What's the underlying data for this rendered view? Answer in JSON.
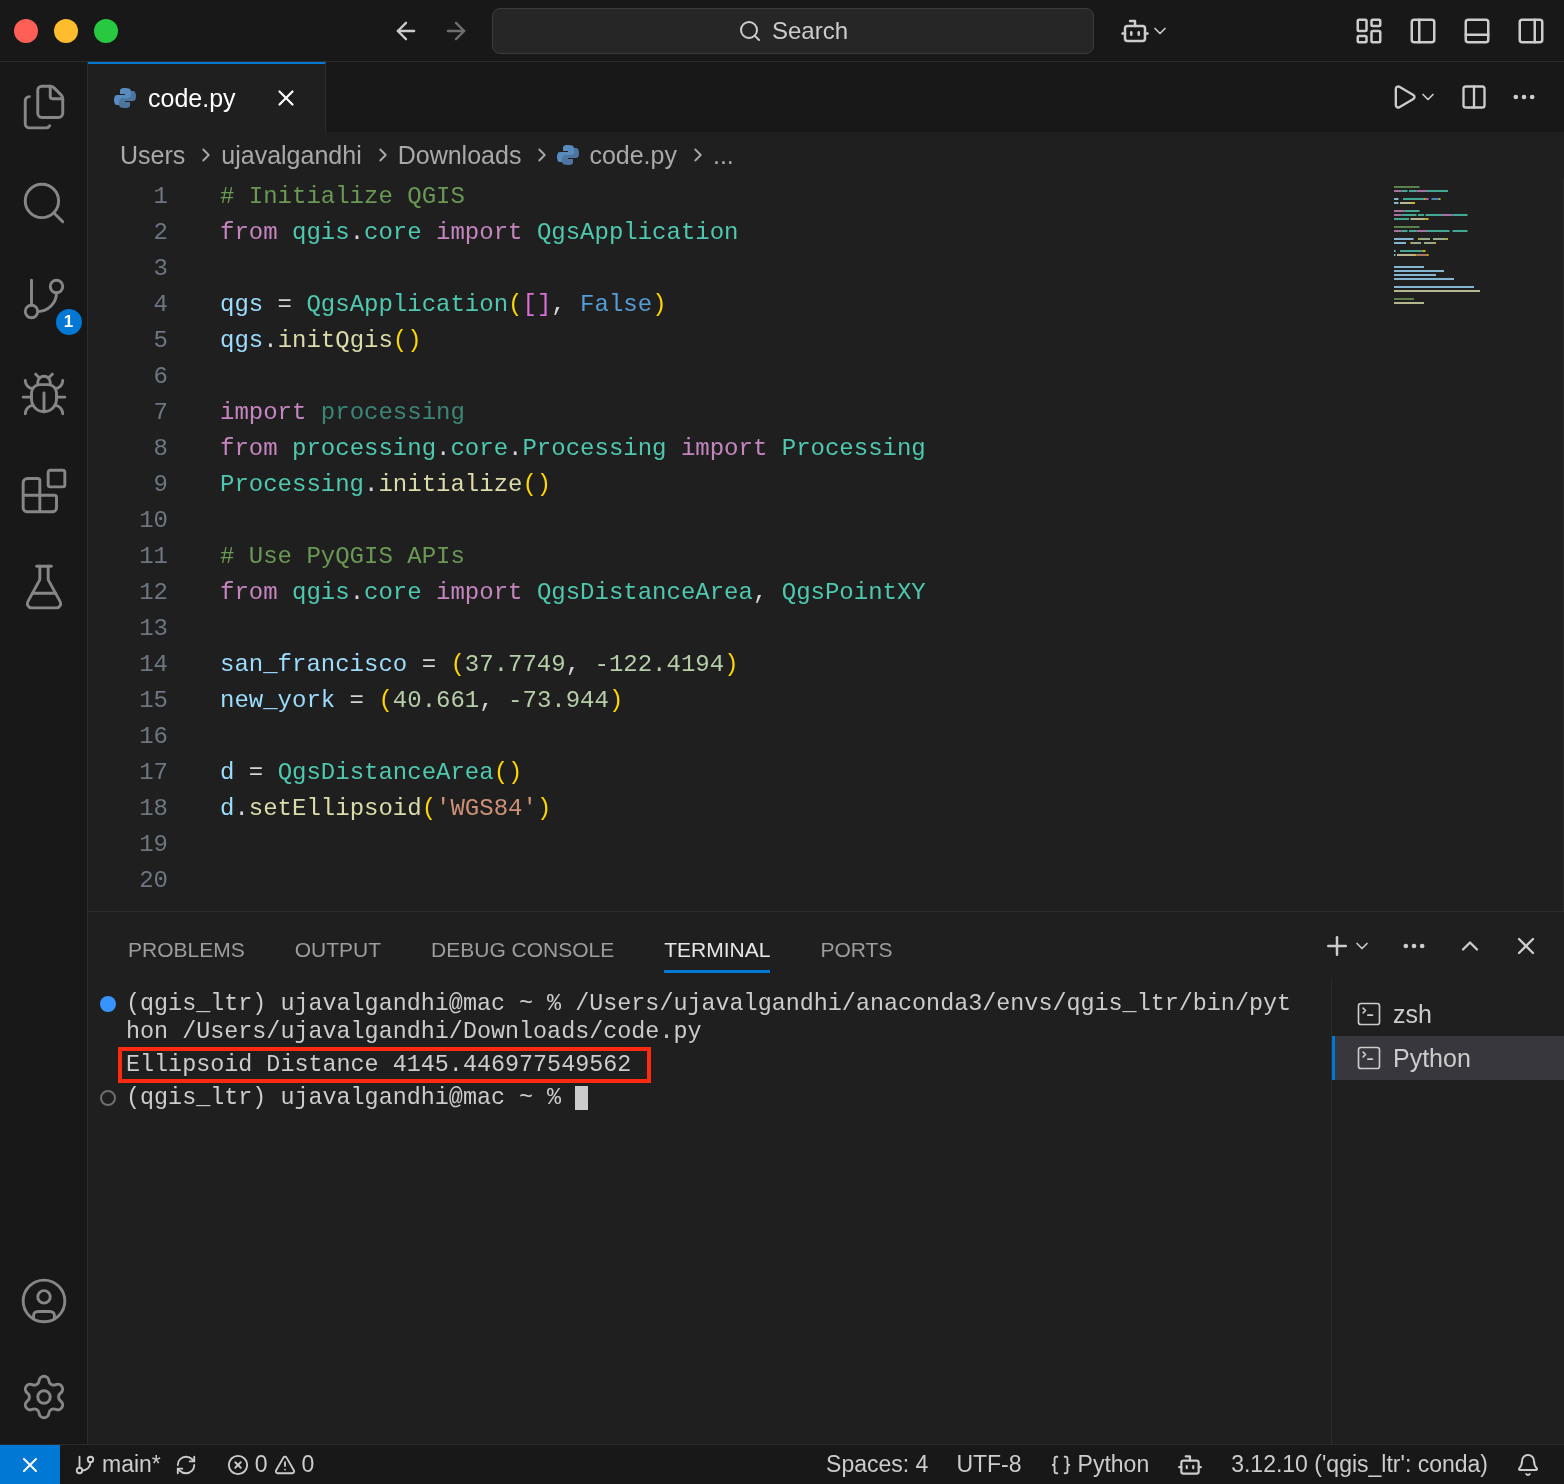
{
  "title_bar": {
    "search": {
      "placeholder": "Search"
    }
  },
  "activity_bar": {
    "items": [
      {
        "kind": "files"
      },
      {
        "kind": "search"
      },
      {
        "kind": "source-control",
        "badge": "1"
      },
      {
        "kind": "run"
      },
      {
        "kind": "extensions"
      },
      {
        "kind": "testing"
      }
    ],
    "bottom": [
      {
        "kind": "account"
      },
      {
        "kind": "settings"
      }
    ]
  },
  "editor": {
    "tabs": [
      {
        "label": "code.py",
        "selected": true
      }
    ],
    "breadcrumbs": [
      {
        "label": "Users",
        "kind": "folder"
      },
      {
        "label": "ujavalgandhi",
        "kind": "folder"
      },
      {
        "label": "Downloads",
        "kind": "folder"
      },
      {
        "label": "code.py",
        "kind": "file"
      },
      {
        "label": "...",
        "kind": "more"
      }
    ],
    "lines": [
      {
        "number": "1",
        "tokens": [
          {
            "text": "# Initialize QGIS",
            "kind": "comment"
          }
        ]
      },
      {
        "number": "2",
        "tokens": [
          {
            "text": "from ",
            "kind": "keyword"
          },
          {
            "text": "qgis",
            "kind": "module"
          },
          {
            "text": ".",
            "kind": "plain"
          },
          {
            "text": "core ",
            "kind": "module"
          },
          {
            "text": "import ",
            "kind": "keyword"
          },
          {
            "text": "QgsApplication",
            "kind": "class"
          }
        ]
      },
      {
        "number": "3"
      },
      {
        "number": "4",
        "tokens": [
          {
            "text": "qgs",
            "kind": "var"
          },
          {
            "text": " = ",
            "kind": "plain"
          },
          {
            "text": "QgsApplication",
            "kind": "class"
          },
          {
            "text": "(",
            "kind": "paren"
          },
          {
            "text": "[]",
            "kind": "bracket"
          },
          {
            "text": ", ",
            "kind": "plain"
          },
          {
            "text": "False",
            "kind": "const"
          },
          {
            "text": ")",
            "kind": "paren"
          }
        ]
      },
      {
        "number": "5",
        "tokens": [
          {
            "text": "qgs",
            "kind": "var"
          },
          {
            "text": ".",
            "kind": "plain"
          },
          {
            "text": "initQgis",
            "kind": "func"
          },
          {
            "text": "()",
            "kind": "paren"
          }
        ]
      },
      {
        "number": "6"
      },
      {
        "number": "7",
        "tokens": [
          {
            "text": "import ",
            "kind": "keyword"
          },
          {
            "text": "processing",
            "kind": "unused"
          }
        ]
      },
      {
        "number": "8",
        "tokens": [
          {
            "text": "from ",
            "kind": "keyword"
          },
          {
            "text": "processing",
            "kind": "module"
          },
          {
            "text": ".",
            "kind": "plain"
          },
          {
            "text": "core",
            "kind": "module"
          },
          {
            "text": ".",
            "kind": "plain"
          },
          {
            "text": "Processing ",
            "kind": "module"
          },
          {
            "text": "import ",
            "kind": "keyword"
          },
          {
            "text": "Processing",
            "kind": "class"
          }
        ]
      },
      {
        "number": "9",
        "tokens": [
          {
            "text": "Processing",
            "kind": "class"
          },
          {
            "text": ".",
            "kind": "plain"
          },
          {
            "text": "initialize",
            "kind": "func"
          },
          {
            "text": "()",
            "kind": "paren"
          }
        ]
      },
      {
        "number": "10"
      },
      {
        "number": "11",
        "tokens": [
          {
            "text": "# Use PyQGIS APIs",
            "kind": "comment"
          }
        ]
      },
      {
        "number": "12",
        "tokens": [
          {
            "text": "from ",
            "kind": "keyword"
          },
          {
            "text": "qgis",
            "kind": "module"
          },
          {
            "text": ".",
            "kind": "plain"
          },
          {
            "text": "core ",
            "kind": "module"
          },
          {
            "text": "import ",
            "kind": "keyword"
          },
          {
            "text": "QgsDistanceArea",
            "kind": "class"
          },
          {
            "text": ", ",
            "kind": "plain"
          },
          {
            "text": "QgsPointXY",
            "kind": "class"
          }
        ]
      },
      {
        "number": "13"
      },
      {
        "number": "14",
        "tokens": [
          {
            "text": "san_francisco",
            "kind": "var"
          },
          {
            "text": " = ",
            "kind": "plain"
          },
          {
            "text": "(",
            "kind": "paren"
          },
          {
            "text": "37.7749",
            "kind": "number"
          },
          {
            "text": ", ",
            "kind": "plain"
          },
          {
            "text": "-122.4194",
            "kind": "number"
          },
          {
            "text": ")",
            "kind": "paren"
          }
        ]
      },
      {
        "number": "15",
        "tokens": [
          {
            "text": "new_york",
            "kind": "var"
          },
          {
            "text": " = ",
            "kind": "plain"
          },
          {
            "text": "(",
            "kind": "paren"
          },
          {
            "text": "40.661",
            "kind": "number"
          },
          {
            "text": ", ",
            "kind": "plain"
          },
          {
            "text": "-73.944",
            "kind": "number"
          },
          {
            "text": ")",
            "kind": "paren"
          }
        ]
      },
      {
        "number": "16"
      },
      {
        "number": "17",
        "tokens": [
          {
            "text": "d",
            "kind": "var"
          },
          {
            "text": " = ",
            "kind": "plain"
          },
          {
            "text": "QgsDistanceArea",
            "kind": "class"
          },
          {
            "text": "()",
            "kind": "paren"
          }
        ]
      },
      {
        "number": "18",
        "tokens": [
          {
            "text": "d",
            "kind": "var"
          },
          {
            "text": ".",
            "kind": "plain"
          },
          {
            "text": "setEllipsoid",
            "kind": "func"
          },
          {
            "text": "(",
            "kind": "paren"
          },
          {
            "text": "'WGS84'",
            "kind": "string"
          },
          {
            "text": ")",
            "kind": "paren"
          }
        ]
      },
      {
        "number": "19"
      },
      {
        "number": "20"
      }
    ]
  },
  "panel": {
    "tabs": [
      {
        "label": "PROBLEMS",
        "selected": false
      },
      {
        "label": "OUTPUT",
        "selected": false
      },
      {
        "label": "DEBUG CONSOLE",
        "selected": false
      },
      {
        "label": "TERMINAL",
        "selected": true
      },
      {
        "label": "PORTS",
        "selected": false
      }
    ],
    "terminal_lines": [
      {
        "text": "(qgis_ltr) ujavalgandhi@mac ~ % /Users/ujavalgandhi/anaconda3/envs/qgis_ltr/bin/pyt",
        "kind": "finished_command"
      },
      {
        "text": "hon /Users/ujavalgandhi/Downloads/code.py",
        "kind": "continuation"
      },
      {
        "text": "Ellipsoid Distance 4145.446977549562",
        "kind": "output",
        "highlighted": true
      },
      {
        "text": "(qgis_ltr) ujavalgandhi@mac ~ %",
        "kind": "prompt",
        "cursor": true
      }
    ],
    "sessions": [
      {
        "label": "zsh",
        "selected": false
      },
      {
        "label": "Python",
        "selected": true
      }
    ]
  },
  "status_bar": {
    "branch": "main*",
    "errors": "0",
    "warnings": "0",
    "right": [
      {
        "label": "Spaces: 4",
        "kind": "text"
      },
      {
        "label": "UTF-8",
        "kind": "text"
      },
      {
        "label": "Python",
        "kind": "language"
      },
      {
        "kind": "copilot"
      },
      {
        "label": "3.12.10 ('qgis_ltr': conda)",
        "kind": "text"
      },
      {
        "kind": "bell"
      }
    ]
  }
}
